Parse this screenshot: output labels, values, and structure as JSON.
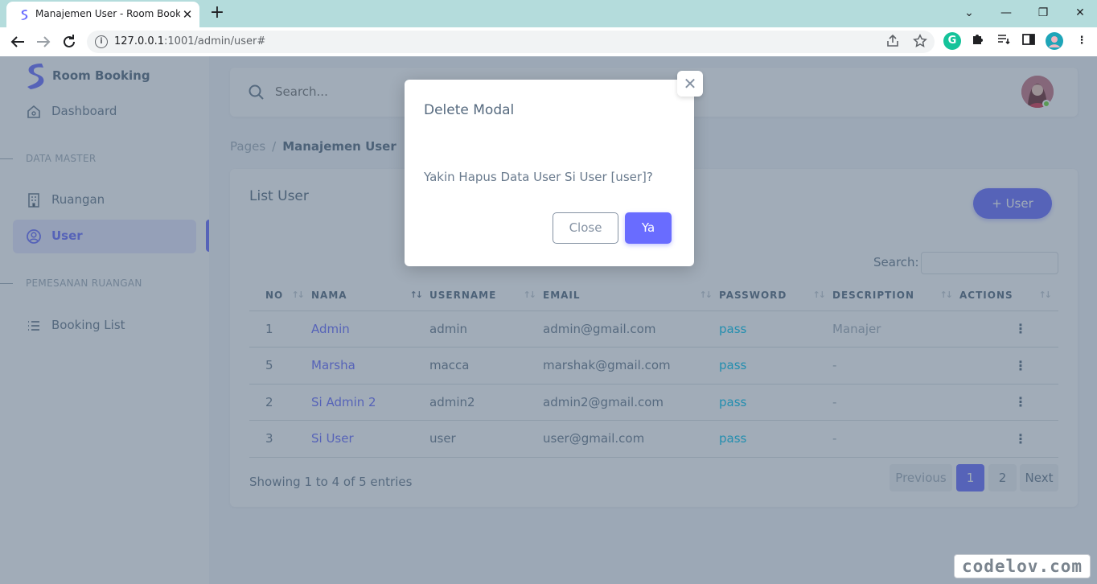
{
  "browser": {
    "tab_title": "Manajemen User - Room Booking",
    "tab_close": "✕",
    "new_tab": "+",
    "url_host": "127.0.0.1",
    "url_path": ":1001/admin/user#",
    "window_controls": {
      "minimize": "—",
      "restore": "❐",
      "close": "✕",
      "dropdown": "⌄"
    }
  },
  "sidebar": {
    "brand": "Room Booking",
    "items": [
      {
        "label": "Dashboard",
        "icon": "home-icon"
      },
      {
        "label": "Ruangan",
        "icon": "building-icon"
      },
      {
        "label": "User",
        "icon": "user-circle-icon"
      },
      {
        "label": "Booking List",
        "icon": "list-icon"
      }
    ],
    "headers": [
      "DATA MASTER",
      "PEMESANAN RUANGAN"
    ]
  },
  "topnav": {
    "search_placeholder": "Search..."
  },
  "breadcrumb": {
    "parent": "Pages",
    "separator": "/",
    "current": "Manajemen User"
  },
  "card": {
    "title": "List User",
    "add_button": "+ User",
    "search_label": "Search:"
  },
  "table": {
    "headers": [
      "NO",
      "NAMA",
      "USERNAME",
      "EMAIL",
      "PASSWORD",
      "DESCRIPTION",
      "ACTIONS"
    ],
    "rows": [
      {
        "no": "1",
        "nama": "Admin",
        "username": "admin",
        "email": "admin@gmail.com",
        "password": "pass",
        "description": "Manajer"
      },
      {
        "no": "5",
        "nama": "Marsha",
        "username": "macca",
        "email": "marshak@gmail.com",
        "password": "pass",
        "description": "-"
      },
      {
        "no": "2",
        "nama": "Si Admin 2",
        "username": "admin2",
        "email": "admin2@gmail.com",
        "password": "pass",
        "description": "-"
      },
      {
        "no": "3",
        "nama": "Si User",
        "username": "user",
        "email": "user@gmail.com",
        "password": "pass",
        "description": "-"
      }
    ],
    "kebab": "⋮"
  },
  "footer": {
    "showing": "Showing 1 to 4 of 5 entries",
    "pagination": {
      "previous": "Previous",
      "page1": "1",
      "page2": "2",
      "next": "Next"
    }
  },
  "modal": {
    "title": "Delete Modal",
    "close_x": "✕",
    "body": "Yakin Hapus Data User Si User [user]?",
    "close_button": "Close",
    "confirm_button": "Ya"
  },
  "watermark": "codelov.com",
  "colors": {
    "primary": "#696cff",
    "info": "#03c3ec",
    "text": "#697a8d",
    "heading": "#566a7f",
    "tabstrip": "#b4dcdc",
    "backdrop": "rgba(67,89,113,0.5)"
  }
}
